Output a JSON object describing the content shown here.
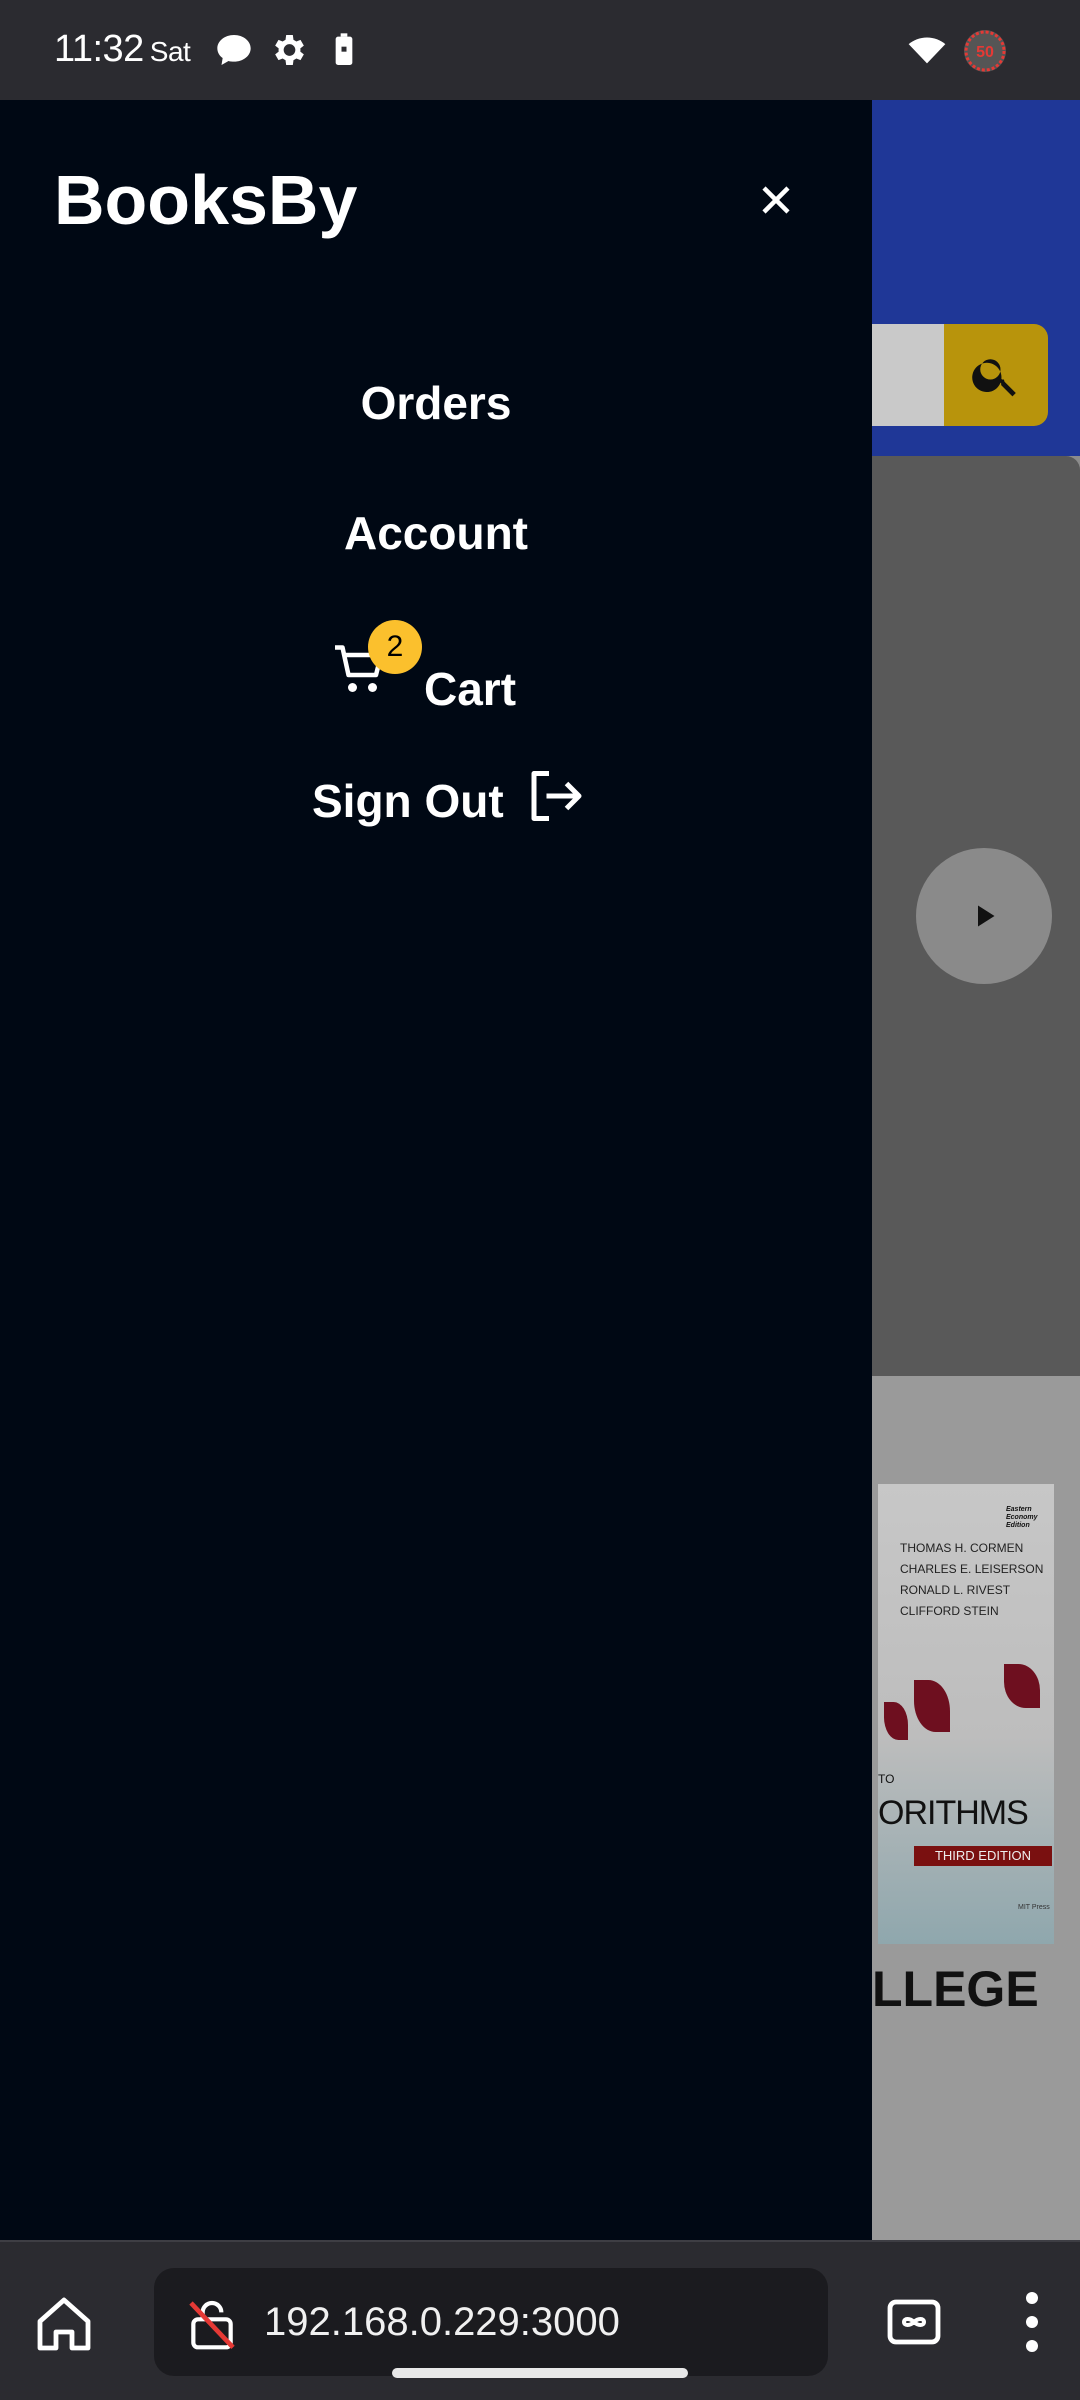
{
  "status_bar": {
    "time": "11:32",
    "day": "Sat",
    "icons": [
      "chat-bubble-icon",
      "settings-icon",
      "battery-saver-icon",
      "wifi-icon",
      "data-saver-icon"
    ],
    "data_saver_label": "50"
  },
  "drawer": {
    "brand": "BooksBy",
    "close_icon": "close-icon",
    "nav": {
      "orders": "Orders",
      "account": "Account",
      "cart": "Cart",
      "cart_badge": "2",
      "sign_out": "Sign Out"
    }
  },
  "background_page": {
    "header_color": "#1f3797",
    "search_button_color": "#b8940c",
    "book": {
      "edition_badge": "Eastern Economy Edition",
      "authors": [
        "THOMAS H. CORMEN",
        "CHARLES E. LEISERSON",
        "RONALD L. RIVEST",
        "CLIFFORD STEIN"
      ],
      "to_fragment": "TO",
      "title_fragment": "ORITHMS",
      "edition": "THIRD EDITION",
      "publisher": "MIT Press"
    },
    "heading_fragment": "LLEGE"
  },
  "browser": {
    "url": "192.168.0.229:3000",
    "icons": [
      "home-icon",
      "insecure-lock-icon",
      "tab-switcher-icon",
      "more-menu-icon"
    ]
  },
  "colors": {
    "drawer_bg": "#000814",
    "badge": "#fbc02d",
    "status_bar_bg": "#2b2b30"
  }
}
